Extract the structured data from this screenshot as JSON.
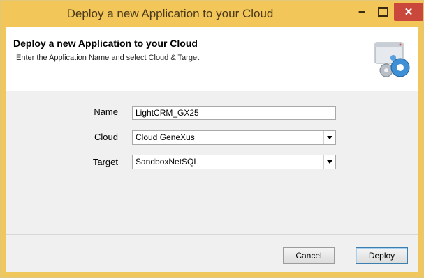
{
  "window": {
    "title": "Deploy a new Application to your Cloud",
    "minimize_glyph": "−",
    "close_glyph": "✕"
  },
  "header": {
    "title": "Deploy a new Application to your Cloud",
    "subtitle": "Enter the Application Name and select Cloud & Target",
    "icon": "deploy-wizard-icon"
  },
  "form": {
    "name_label": "Name",
    "name_value": "LightCRM_GX25",
    "cloud_label": "Cloud",
    "cloud_value": "Cloud GeneXus",
    "target_label": "Target",
    "target_value": "SandboxNetSQL"
  },
  "buttons": {
    "cancel": "Cancel",
    "deploy": "Deploy"
  },
  "colors": {
    "titlebar": "#f3c65a",
    "close": "#c9483b"
  }
}
